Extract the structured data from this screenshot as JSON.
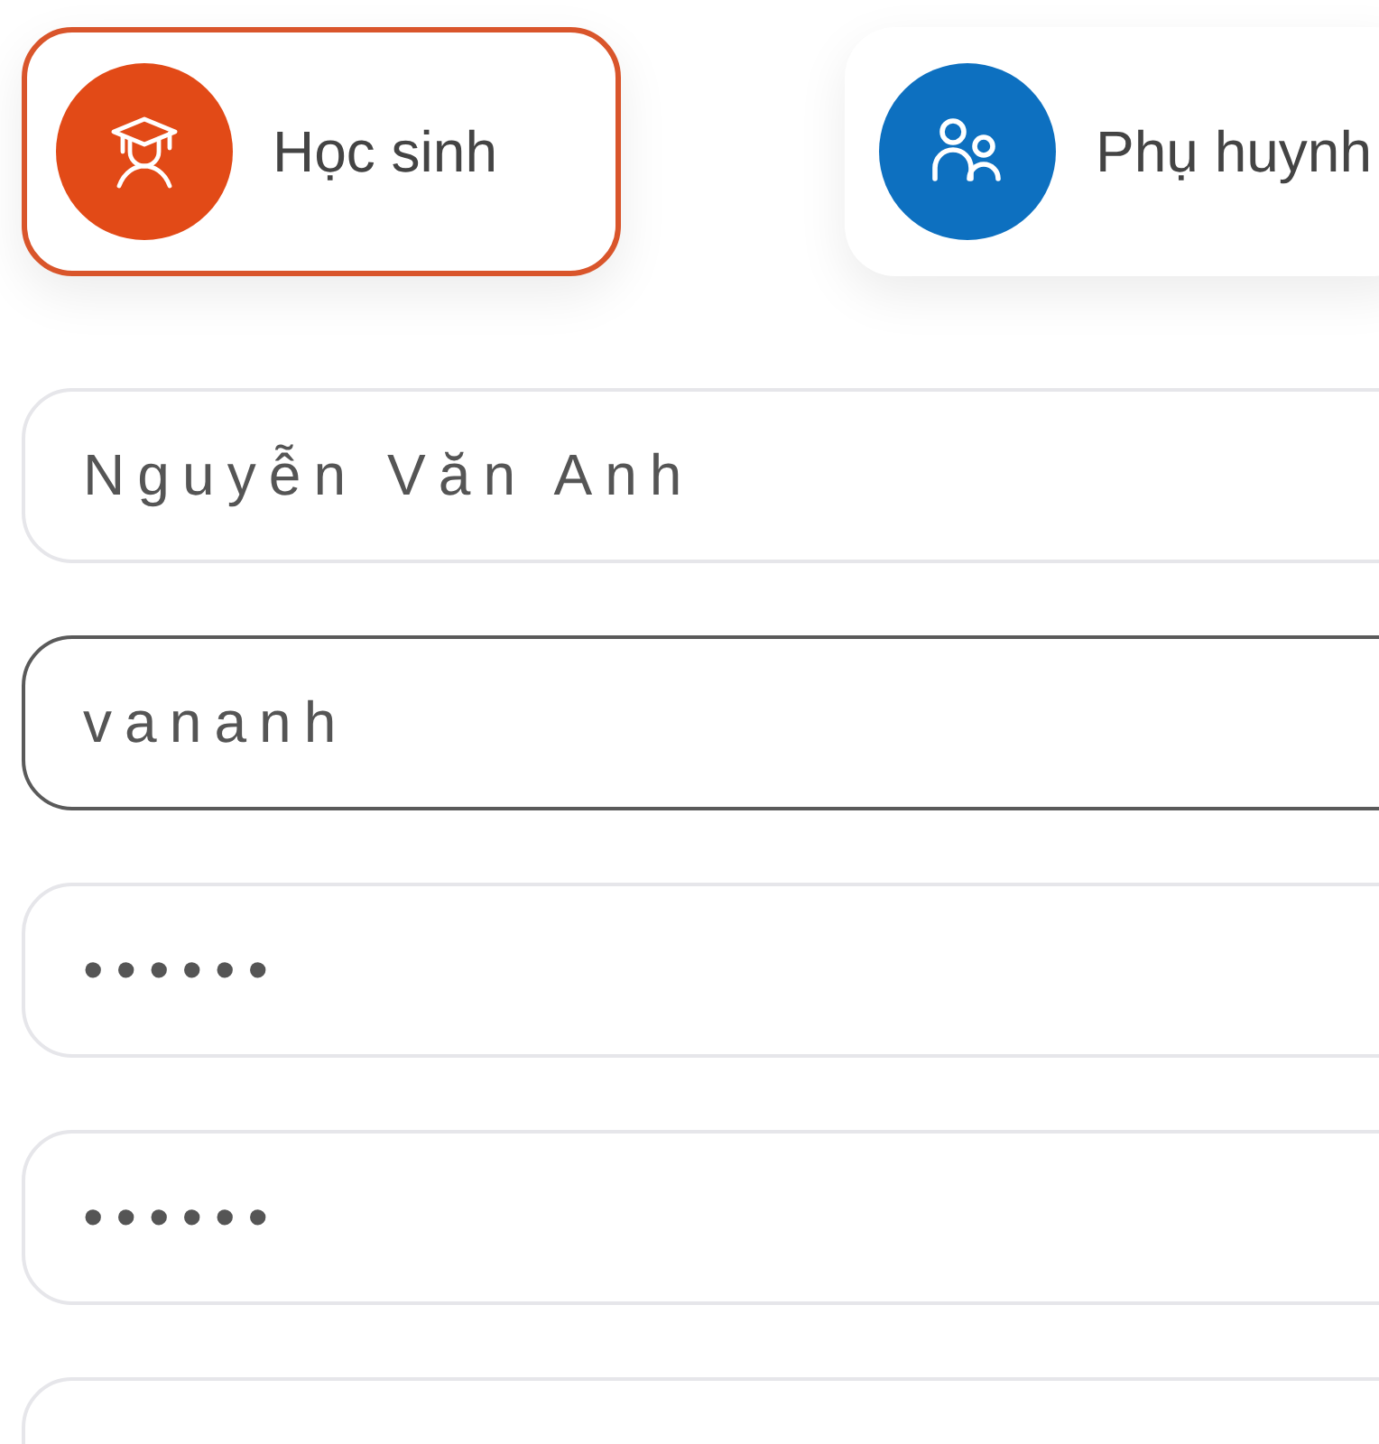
{
  "roles": [
    {
      "kind": "student",
      "label": "Học sinh",
      "selected": true
    },
    {
      "kind": "parent",
      "label": "Phụ huynh",
      "selected": false
    }
  ],
  "fields": [
    {
      "value": "Nguyễn Văn Anh",
      "focused": false
    },
    {
      "value": "vananh",
      "focused": true
    },
    {
      "value": "••••••",
      "focused": false
    },
    {
      "value": "••••••",
      "focused": false
    },
    {
      "focused": false
    }
  ]
}
